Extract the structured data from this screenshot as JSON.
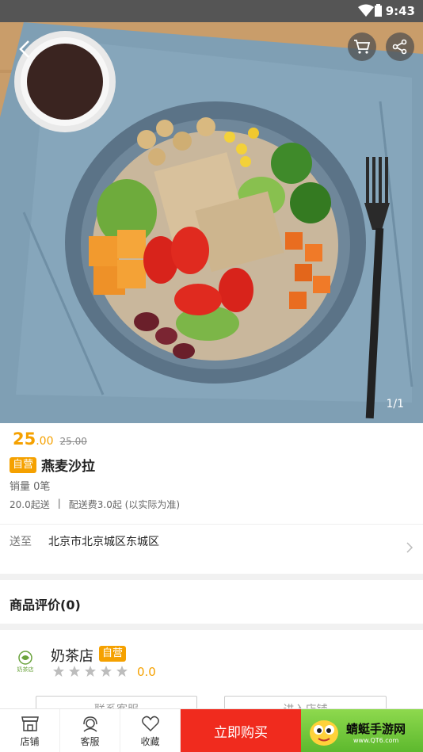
{
  "status_bar": {
    "time": "9:43"
  },
  "hero": {
    "indicator": "1/1"
  },
  "product": {
    "price_int": "25",
    "price_dec": ".00",
    "original_price": "25.00",
    "badge": "自营",
    "name": "燕麦沙拉",
    "sales": "销量 0笔",
    "min_order": "20.0起送",
    "separator": "|",
    "delivery_fee": "配送费3.0起 (以实际为准)"
  },
  "shipping": {
    "label": "送至",
    "address": "北京市北京城区东城区"
  },
  "reviews": {
    "title": "商品评价(0)"
  },
  "shop": {
    "logo_text": "奶茶店",
    "name": "奶茶店",
    "badge": "自营",
    "rating": "0.0",
    "stars": 5,
    "contact_label": "联系客服",
    "enter_label": "进入店铺"
  },
  "bottom_bar": {
    "tabs": [
      {
        "label": "店铺",
        "icon": "store-icon"
      },
      {
        "label": "客服",
        "icon": "headset-icon"
      },
      {
        "label": "收藏",
        "icon": "heart-icon"
      }
    ],
    "buy_label": "立即购买",
    "ad_title": "蜻蜓手游网",
    "ad_url": "www.QT6.com"
  },
  "colors": {
    "accent": "#f5a100",
    "buy": "#f02b1e",
    "ad": "#6cc43a"
  }
}
